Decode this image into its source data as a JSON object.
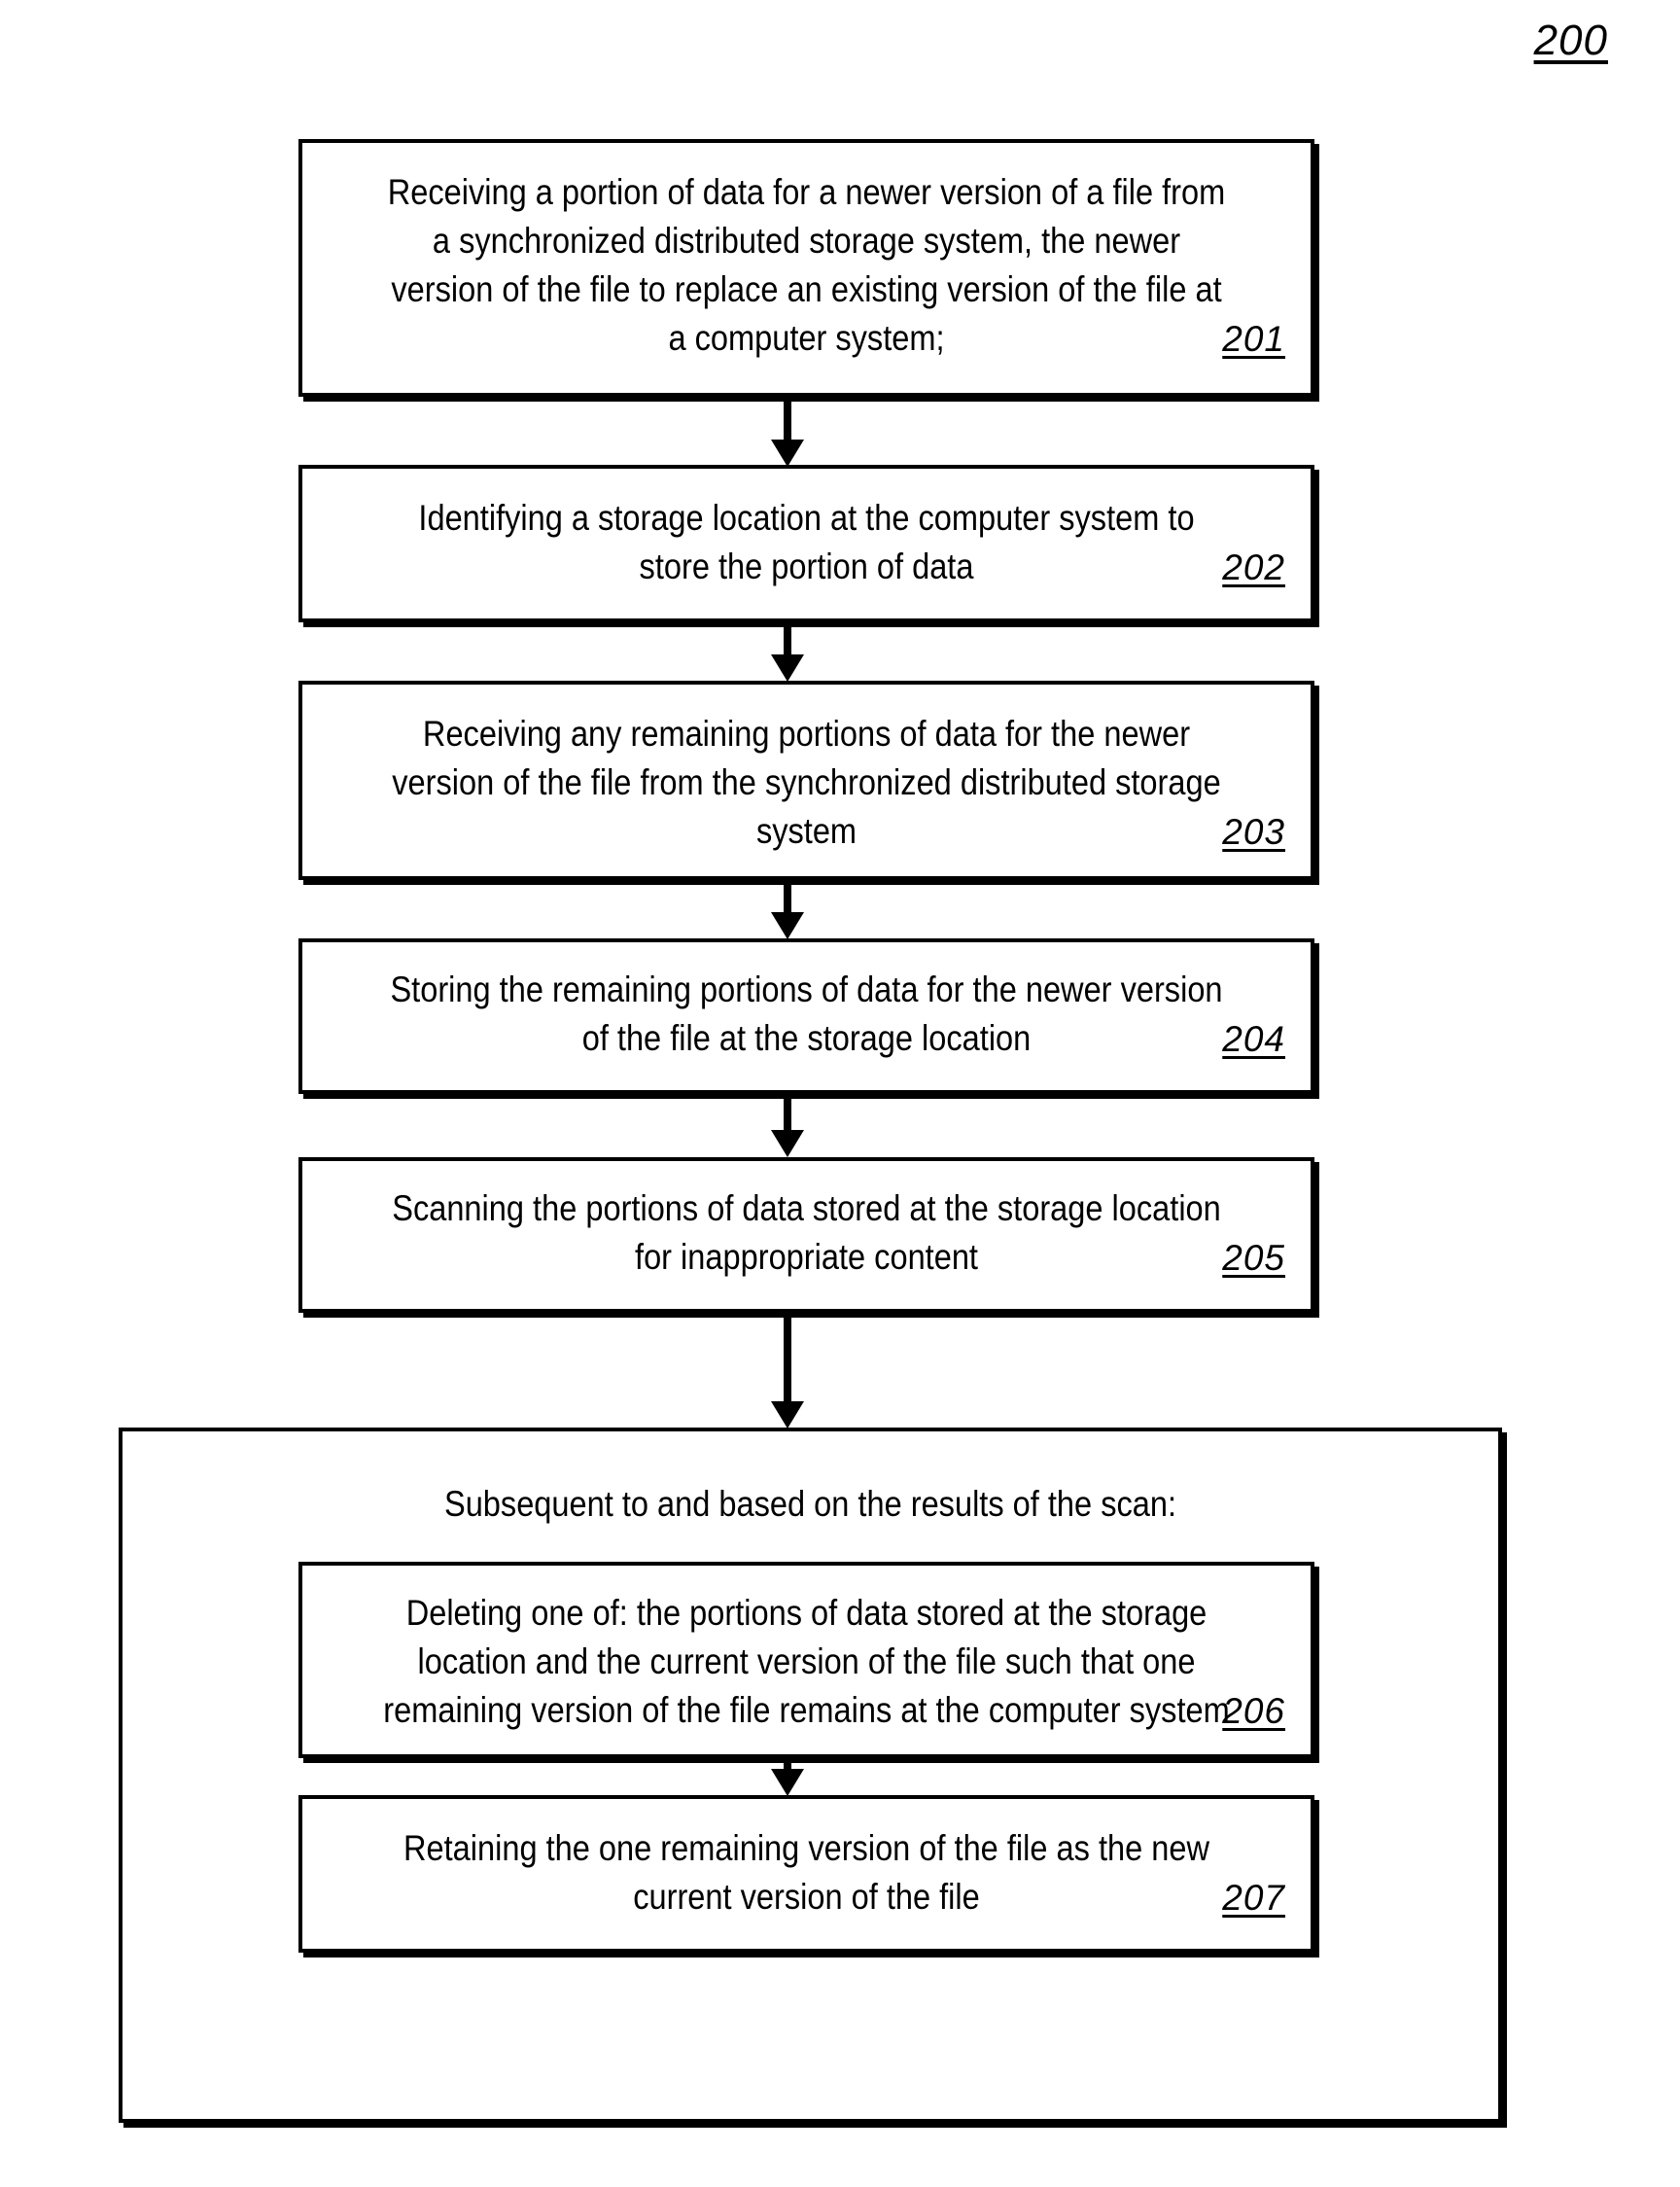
{
  "figure": {
    "number": "200"
  },
  "flowchart": {
    "type": "patent-method-flowchart",
    "steps": [
      {
        "id": "201",
        "ref": "201",
        "text": "Receiving a portion of data for a newer version of a file from a synchronized distributed storage system, the newer version of the file to replace an existing version of the file at a computer system;"
      },
      {
        "id": "202",
        "ref": "202",
        "text": "Identifying a storage location at the computer system to store the portion of data"
      },
      {
        "id": "203",
        "ref": "203",
        "text": "Receiving any remaining portions of data for the newer version of the file from the synchronized distributed storage system"
      },
      {
        "id": "204",
        "ref": "204",
        "text": "Storing the remaining portions of data for the newer version of the file at the storage location"
      },
      {
        "id": "205",
        "ref": "205",
        "text": "Scanning the portions of data stored at the storage location for inappropriate content"
      },
      {
        "id": "206",
        "ref": "206",
        "text": "Deleting one of: the portions of data stored at the storage location and the current version of the file such that one remaining version of the file remains at the computer system"
      },
      {
        "id": "207",
        "ref": "207",
        "text": "Retaining the one remaining version of the file as the new current version of the file"
      }
    ],
    "group": {
      "heading": "Subsequent to and based on the results of the scan:",
      "contains": [
        "206",
        "207"
      ]
    },
    "connectors": [
      {
        "from": "201",
        "to": "202",
        "kind": "arrow-down"
      },
      {
        "from": "202",
        "to": "203",
        "kind": "arrow-down"
      },
      {
        "from": "203",
        "to": "204",
        "kind": "arrow-down"
      },
      {
        "from": "204",
        "to": "205",
        "kind": "arrow-down"
      },
      {
        "from": "205",
        "to": "group",
        "kind": "arrow-down"
      },
      {
        "from": "206",
        "to": "207",
        "kind": "arrow-down"
      }
    ],
    "colors": {
      "stroke": "#000000",
      "fill": "#ffffff",
      "text": "#000000"
    }
  }
}
